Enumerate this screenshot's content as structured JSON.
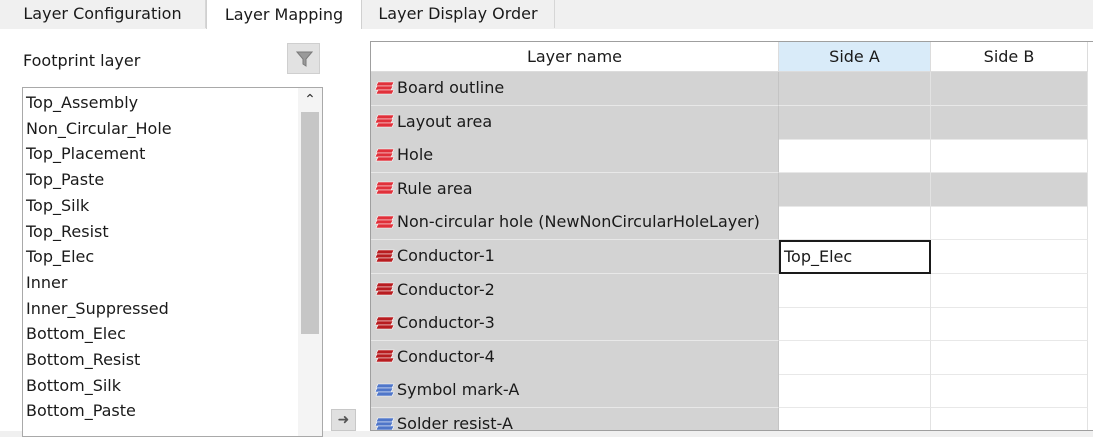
{
  "tabs": [
    "Layer Configuration",
    "Layer Mapping",
    "Layer Display Order"
  ],
  "footprint_layer_label": "Footprint layer",
  "footprint_layers": [
    "Top_Assembly",
    "Non_Circular_Hole",
    "Top_Placement",
    "Top_Paste",
    "Top_Silk",
    "Top_Resist",
    "Top_Elec",
    "Inner",
    "Inner_Suppressed",
    "Bottom_Elec",
    "Bottom_Resist",
    "Bottom_Silk",
    "Bottom_Paste"
  ],
  "grid": {
    "headers": {
      "layer_name": "Layer name",
      "side_a": "Side A",
      "side_b": "Side B"
    },
    "rows": [
      {
        "name": "Board outline",
        "icon": "red-layer-icon",
        "side_a": "",
        "side_b": ""
      },
      {
        "name": "Layout area",
        "icon": "red-layer-icon",
        "side_a": "",
        "side_b": ""
      },
      {
        "name": "Hole",
        "icon": "red-layer-icon",
        "side_a": "",
        "side_b": ""
      },
      {
        "name": "Rule area",
        "icon": "red-layer-icon",
        "side_a": "",
        "side_b": ""
      },
      {
        "name": "Non-circular hole (NewNonCircularHoleLayer)",
        "icon": "red-layer-icon",
        "side_a": "",
        "side_b": ""
      },
      {
        "name": "Conductor-1",
        "icon": "dark-red-layer-icon",
        "side_a": "Top_Elec",
        "side_b": ""
      },
      {
        "name": "Conductor-2",
        "icon": "dark-red-layer-icon",
        "side_a": "",
        "side_b": ""
      },
      {
        "name": "Conductor-3",
        "icon": "dark-red-layer-icon",
        "side_a": "",
        "side_b": ""
      },
      {
        "name": "Conductor-4",
        "icon": "dark-red-layer-icon",
        "side_a": "",
        "side_b": ""
      },
      {
        "name": "Symbol mark-A",
        "icon": "blue-layer-icon",
        "side_a": "",
        "side_b": ""
      },
      {
        "name": "Solder resist-A",
        "icon": "blue-layer-icon",
        "side_a": "",
        "side_b": ""
      }
    ]
  },
  "colors": {
    "selected_header": "#d9ebf9",
    "disabled_cell": "#d3d3d3",
    "red_icon": "#e0303a",
    "dark_red_icon": "#b81c20",
    "blue_icon": "#4f76c9"
  }
}
